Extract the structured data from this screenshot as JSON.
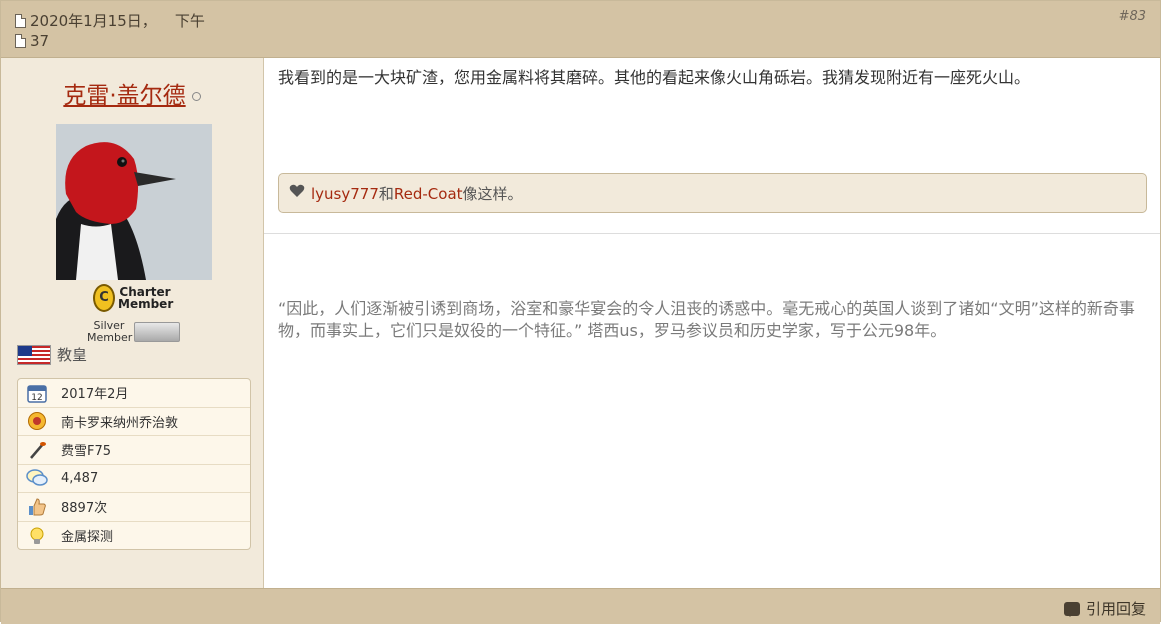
{
  "header": {
    "date": "2020年1月15日，",
    "time_of_day": "下午",
    "line2": "37",
    "post_number": "#83"
  },
  "user": {
    "name": "克雷·盖尔德",
    "badge_charter": "Charter Member",
    "badge_silver": "Silver Member",
    "role": "教皇",
    "info": [
      {
        "icon": "calendar-icon",
        "text": "2017年2月"
      },
      {
        "icon": "location-icon",
        "text": "南卡罗来纳州乔治敦"
      },
      {
        "icon": "detector-icon",
        "text": "费雪F75"
      },
      {
        "icon": "posts-icon",
        "text": "4,487"
      },
      {
        "icon": "thumbs-up-icon",
        "text": "8897次"
      },
      {
        "icon": "lightbulb-icon",
        "text": "金属探测"
      }
    ]
  },
  "post": {
    "body": "我看到的是一大块矿渣，您用金属料将其磨碎。其他的看起来像火山角砾岩。我猜发现附近有一座死火山。",
    "likes": {
      "user1": "lyusy777",
      "and": "和",
      "user2": "Red-Coat",
      "suffix": "像这样。"
    },
    "signature": "“因此，人们逐渐被引诱到商场，浴室和豪华宴会的令人沮丧的诱惑中。毫无戒心的英国人谈到了诸如“文明”这样的新奇事物，而事实上，它们只是奴役的一个特征。” 塔西us，罗马参议员和历史学家，写于公元98年。"
  },
  "footer": {
    "reply_label": "引用回复"
  },
  "colors": {
    "header_bg": "#d4c3a4",
    "sidebar_bg": "#f2eadb",
    "link": "#a52a10"
  }
}
